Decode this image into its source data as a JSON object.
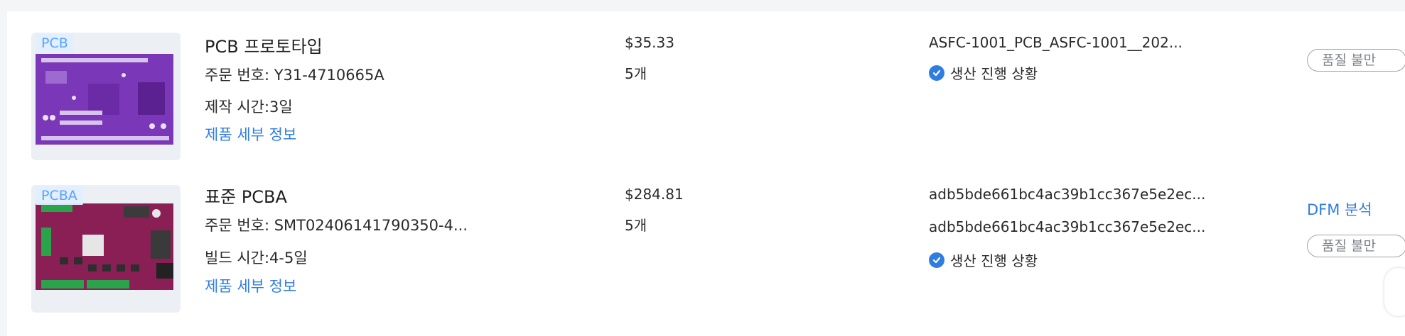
{
  "orders": [
    {
      "tag": "PCB",
      "title": "PCB 프로토타입",
      "order_no": "주문 번호: Y31-4710665A",
      "lead_time": "제작 시간:3일",
      "details_link": "제품 세부 정보",
      "price": "$35.33",
      "qty": "5개",
      "file": "ASFC-1001_PCB_ASFC-1001__202...",
      "status": "생산 진행 상황",
      "quality_button": "품질 불만"
    },
    {
      "tag": "PCBA",
      "title": "표준 PCBA",
      "order_no": "주문 번호: SMT02406141790350-4...",
      "lead_time": "빌드 시간:4-5일",
      "details_link": "제품 세부 정보",
      "price": "$284.81",
      "qty": "5개",
      "file1": "adb5bde661bc4ac39b1cc367e5e2ec...",
      "file2": "adb5bde661bc4ac39b1cc367e5e2ec...",
      "status": "생산 진행 상황",
      "dfm_link": "DFM 분석",
      "quality_button": "품질 불만"
    }
  ],
  "colors": {
    "accent": "#2f7de1",
    "pcb_board": "#7a37b8",
    "pcba_board": "#8a1f56"
  }
}
